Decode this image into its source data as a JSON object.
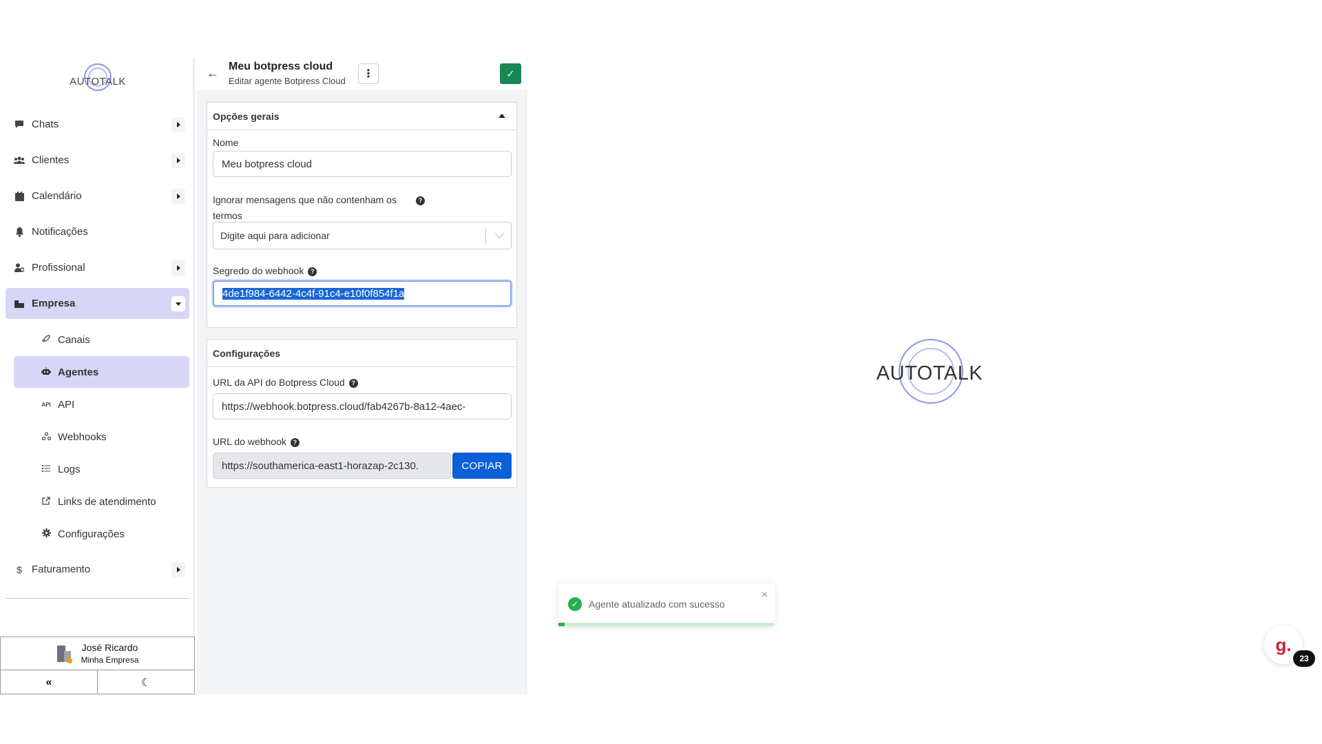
{
  "brand": {
    "logo_text": "AUTOTALK",
    "accent": "#8c93e6"
  },
  "sidebar": {
    "items": [
      {
        "label": "Chats",
        "icon": "chat-icon",
        "expandable": true
      },
      {
        "label": "Clientes",
        "icon": "users-icon",
        "expandable": true
      },
      {
        "label": "Calendário",
        "icon": "calendar-icon",
        "expandable": true
      },
      {
        "label": "Notificações",
        "icon": "bell-icon",
        "expandable": false
      },
      {
        "label": "Profissional",
        "icon": "user-tie-icon",
        "expandable": true
      },
      {
        "label": "Empresa",
        "icon": "building-icon",
        "expandable": true,
        "active": true
      }
    ],
    "subitems": [
      {
        "label": "Canais",
        "icon": "rocket-icon"
      },
      {
        "label": "Agentes",
        "icon": "robot-icon",
        "active": true
      },
      {
        "label": "API",
        "icon": "api-icon"
      },
      {
        "label": "Webhooks",
        "icon": "webhook-icon"
      },
      {
        "label": "Logs",
        "icon": "list-icon"
      },
      {
        "label": "Links de atendimento",
        "icon": "external-link-icon"
      },
      {
        "label": "Configurações",
        "icon": "gear-icon"
      }
    ],
    "billing": {
      "label": "Faturamento",
      "icon": "dollar-icon"
    },
    "user": {
      "name": "José Ricardo",
      "company": "Minha Empresa"
    },
    "collapse_glyph": "«",
    "theme_glyph": "☾"
  },
  "header": {
    "title": "Meu botpress cloud",
    "subtitle": "Editar agente Botpress Cloud",
    "back_glyph": "←",
    "more_glyph": "⋮",
    "save_glyph": "✓"
  },
  "general": {
    "section_title": "Opções gerais",
    "name_label": "Nome",
    "name_value": "Meu botpress cloud",
    "ignore_label_line1": "Ignorar mensagens que não contenham os",
    "ignore_label_line2": "termos",
    "ignore_placeholder": "Digite aqui para adicionar",
    "secret_label": "Segredo do webhook",
    "secret_value": "4de1f984-6442-4c4f-91c4-e10f0f854f1a"
  },
  "config": {
    "section_title": "Configurações",
    "api_url_label": "URL da API do Botpress Cloud",
    "api_url_value": "https://webhook.botpress.cloud/fab4267b-8a12-4aec-",
    "webhook_url_label": "URL do webhook",
    "webhook_url_value": "https://southamerica-east1-horazap-2c130.",
    "copy_label": "COPIAR"
  },
  "toast": {
    "message": "Agente atualizado com sucesso",
    "close_glyph": "×",
    "progress": 0.03,
    "status_color": "#22b14c"
  },
  "chat_widget": {
    "glyph": "g.",
    "badge": "23"
  }
}
